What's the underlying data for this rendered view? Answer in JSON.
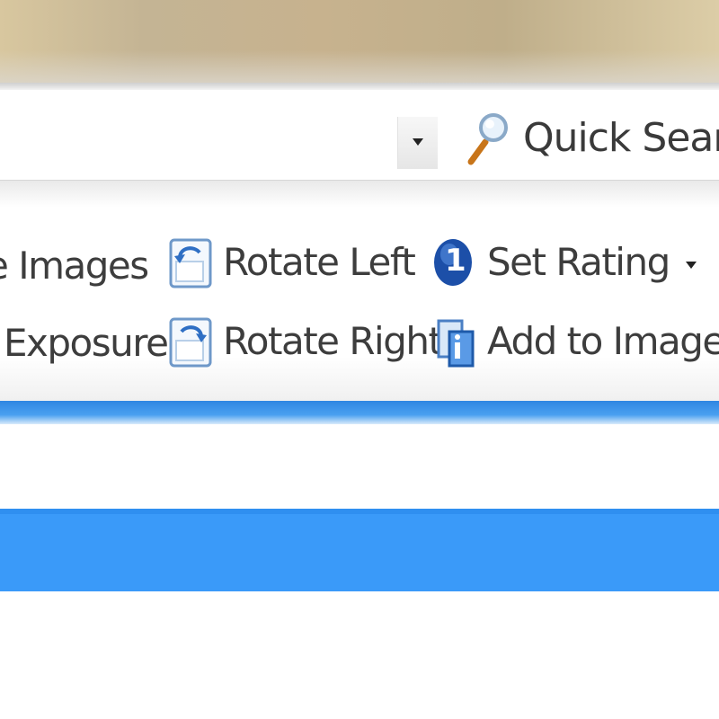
{
  "address_bar": {
    "dropdown_icon": "chevron-down-icon",
    "search_icon": "magnifier-icon",
    "quick_search_label": "Quick Search"
  },
  "toolbar": {
    "images_label": "e Images",
    "exposure_label": "Exposure",
    "rotate_left_label": "Rotate Left",
    "rotate_right_label": "Rotate Right",
    "set_rating_label": "Set Rating",
    "add_to_basket_label": "Add to Image Ba",
    "rating_badge": "1"
  },
  "colors": {
    "accent_blue": "#3a9af9",
    "separator_blue": "#2f86e2",
    "label_text": "#3d3d3d"
  }
}
